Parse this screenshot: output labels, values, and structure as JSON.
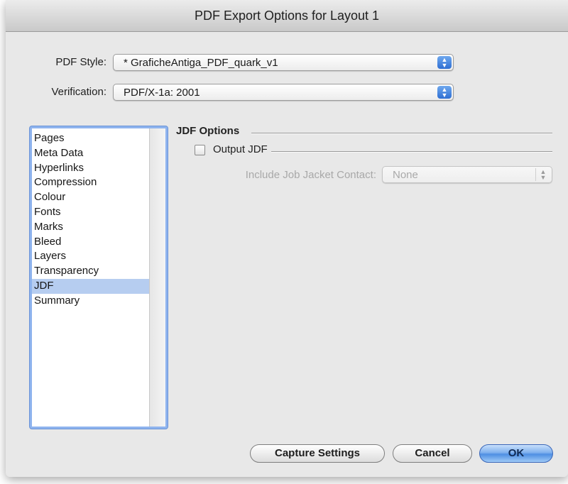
{
  "window": {
    "title": "PDF Export Options for Layout 1"
  },
  "pdf_style": {
    "label": "PDF Style:",
    "value": "* GraficheAntiga_PDF_quark_v1"
  },
  "verification": {
    "label": "Verification:",
    "value": "PDF/X-1a: 2001"
  },
  "sidebar": {
    "items": [
      {
        "label": "Pages"
      },
      {
        "label": "Meta Data"
      },
      {
        "label": "Hyperlinks"
      },
      {
        "label": "Compression"
      },
      {
        "label": "Colour"
      },
      {
        "label": "Fonts"
      },
      {
        "label": "Marks"
      },
      {
        "label": "Bleed"
      },
      {
        "label": "Layers"
      },
      {
        "label": "Transparency"
      },
      {
        "label": "JDF"
      },
      {
        "label": "Summary"
      }
    ],
    "selected": "JDF"
  },
  "jdf": {
    "group_title": "JDF Options",
    "output_label": "Output JDF",
    "output_checked": false,
    "contact_label": "Include Job Jacket Contact:",
    "contact_value": "None"
  },
  "buttons": {
    "capture": "Capture Settings",
    "cancel": "Cancel",
    "ok": "OK"
  },
  "icons": {
    "popup_arrows": "up-down-arrows-icon"
  }
}
